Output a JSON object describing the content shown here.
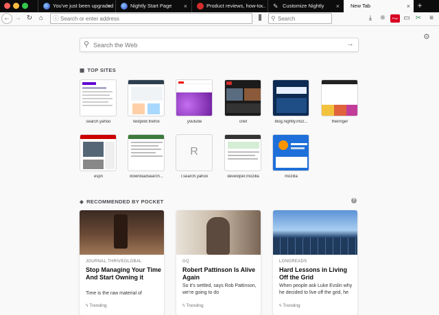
{
  "tabs": [
    {
      "title": "You've just been upgraded"
    },
    {
      "title": "Nightly Start Page"
    },
    {
      "title": "Product reviews, how-to..."
    },
    {
      "title": "Customize Nightly"
    },
    {
      "title": "New Tab",
      "active": true
    }
  ],
  "close_glyph": "×",
  "new_tab_glyph": "+",
  "toolbar": {
    "url_placeholder": "Search or enter address",
    "search_placeholder": "Search",
    "badge": "Ezgr"
  },
  "newtab": {
    "search_placeholder": "Search the Web",
    "top_sites_heading": "TOP SITES",
    "pocket_heading": "RECOMMENDED BY POCKET",
    "top_sites": [
      "search.yahoo",
      "testpilot.firefox",
      "youtube",
      "cnet",
      "blog.nightly.moz...",
      "theringer",
      "espn",
      "downloadsearch...",
      "r.search.yahoo",
      "developer.mozilla",
      "mozilla"
    ],
    "placeholder_letter": "R",
    "cards": [
      {
        "source": "JOURNAL.THRIVEGLOBAL",
        "title": "Stop Managing Your Time And Start Owning it",
        "excerpt": "Time is the raw material of",
        "trending": "Trending"
      },
      {
        "source": "GQ",
        "title": "Robert Pattinson Is Alive Again",
        "excerpt": "So it's settled, says Rob Pattinson, we're going to do",
        "trending": "Trending"
      },
      {
        "source": "LONGREADS",
        "title": "Hard Lessons in Living Off the Grid",
        "excerpt": "When people ask Luke Evslin why he decided to live off the grid, he",
        "trending": "Trending"
      }
    ]
  },
  "colors": {
    "tabbar": "#0c0c0d",
    "page_bg": "#f9f9fa",
    "accent": "#0060df"
  }
}
